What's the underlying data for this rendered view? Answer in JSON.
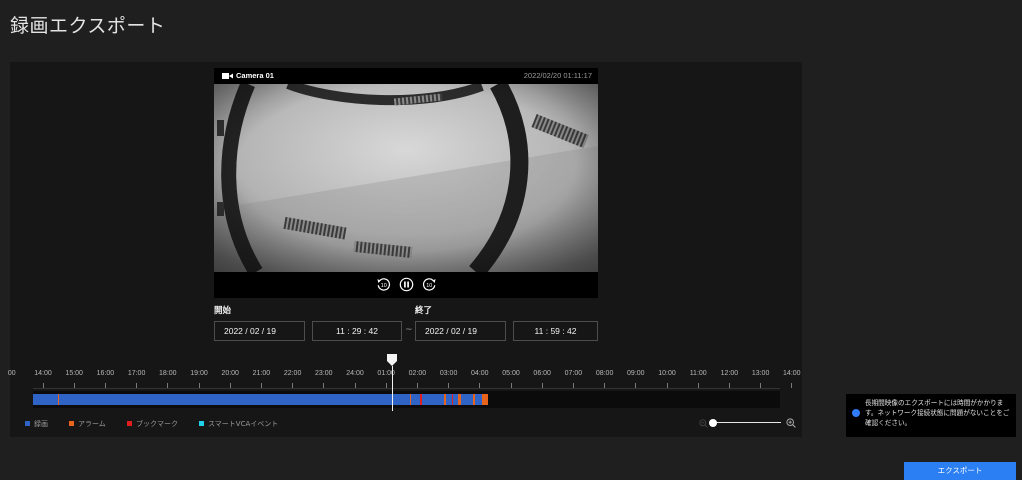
{
  "page": {
    "title": "録画エクスポート"
  },
  "player": {
    "camera_name": "Camera 01",
    "timestamp": "2022/02/20 01:11:17",
    "rewind_label": "10",
    "forward_label": "10"
  },
  "range": {
    "start_label": "開始",
    "end_label": "終了",
    "start_date": "2022 / 02 / 19",
    "start_time": "11 : 29 : 42",
    "separator": "~",
    "end_date": "2022 / 02 / 19",
    "end_time": "11 : 59 : 42"
  },
  "timeline": {
    "axis_labels": [
      "00",
      "14:00",
      "15:00",
      "16:00",
      "17:00",
      "18:00",
      "19:00",
      "20:00",
      "21:00",
      "22:00",
      "23:00",
      "24:00",
      "01:00",
      "02:00",
      "03:00",
      "04:00",
      "05:00",
      "06:00",
      "07:00",
      "08:00",
      "09:00",
      "10:00",
      "11:00",
      "12:00",
      "13:00",
      "14:00"
    ],
    "recordings": [
      {
        "start": "2022/02/19 13:41",
        "end": "2022/02/20 04:16"
      }
    ],
    "alarms": [
      {
        "start": "2022/02/19 14:28",
        "end": "2022/02/19 14:31"
      },
      {
        "start": "2022/02/20 01:45",
        "end": "2022/02/20 01:48"
      },
      {
        "start": "2022/02/20 02:51",
        "end": "2022/02/20 02:55"
      },
      {
        "start": "2022/02/20 03:19",
        "end": "2022/02/20 03:23"
      },
      {
        "start": "2022/02/20 03:47",
        "end": "2022/02/20 03:51"
      },
      {
        "start": "2022/02/20 04:04",
        "end": "2022/02/20 04:16"
      }
    ],
    "bookmarks": [
      {
        "time": "2022/02/20 02:05"
      },
      {
        "time": "2022/02/20 03:06"
      }
    ],
    "zoom_level": 0.02
  },
  "legend": {
    "items": [
      {
        "label": "録画",
        "color": "#2f63c6"
      },
      {
        "label": "アラーム",
        "color": "#e8641c"
      },
      {
        "label": "ブックマーク",
        "color": "#e11d1d"
      },
      {
        "label": "スマートVCAイベント",
        "color": "#20d0e8"
      }
    ]
  },
  "notice": {
    "lines": [
      "長期間映像のエクスポートには時間がかかりま",
      "す。ネットワーク接続状態に問題がないことをご",
      "確認ください。"
    ]
  },
  "actions": {
    "export_label": "エクスポート"
  },
  "icons": {
    "camera": "video-camera-icon",
    "rewind": "rewind-10-icon",
    "pause": "pause-icon",
    "forward": "forward-10-icon",
    "zoom_out": "zoom-out-icon",
    "zoom_in": "zoom-in-icon",
    "info": "info-icon",
    "playhead": "playhead-marker-icon"
  },
  "colors": {
    "accent": "#2b7ff3",
    "background": "#1f1f1f",
    "panel": "#161616"
  }
}
